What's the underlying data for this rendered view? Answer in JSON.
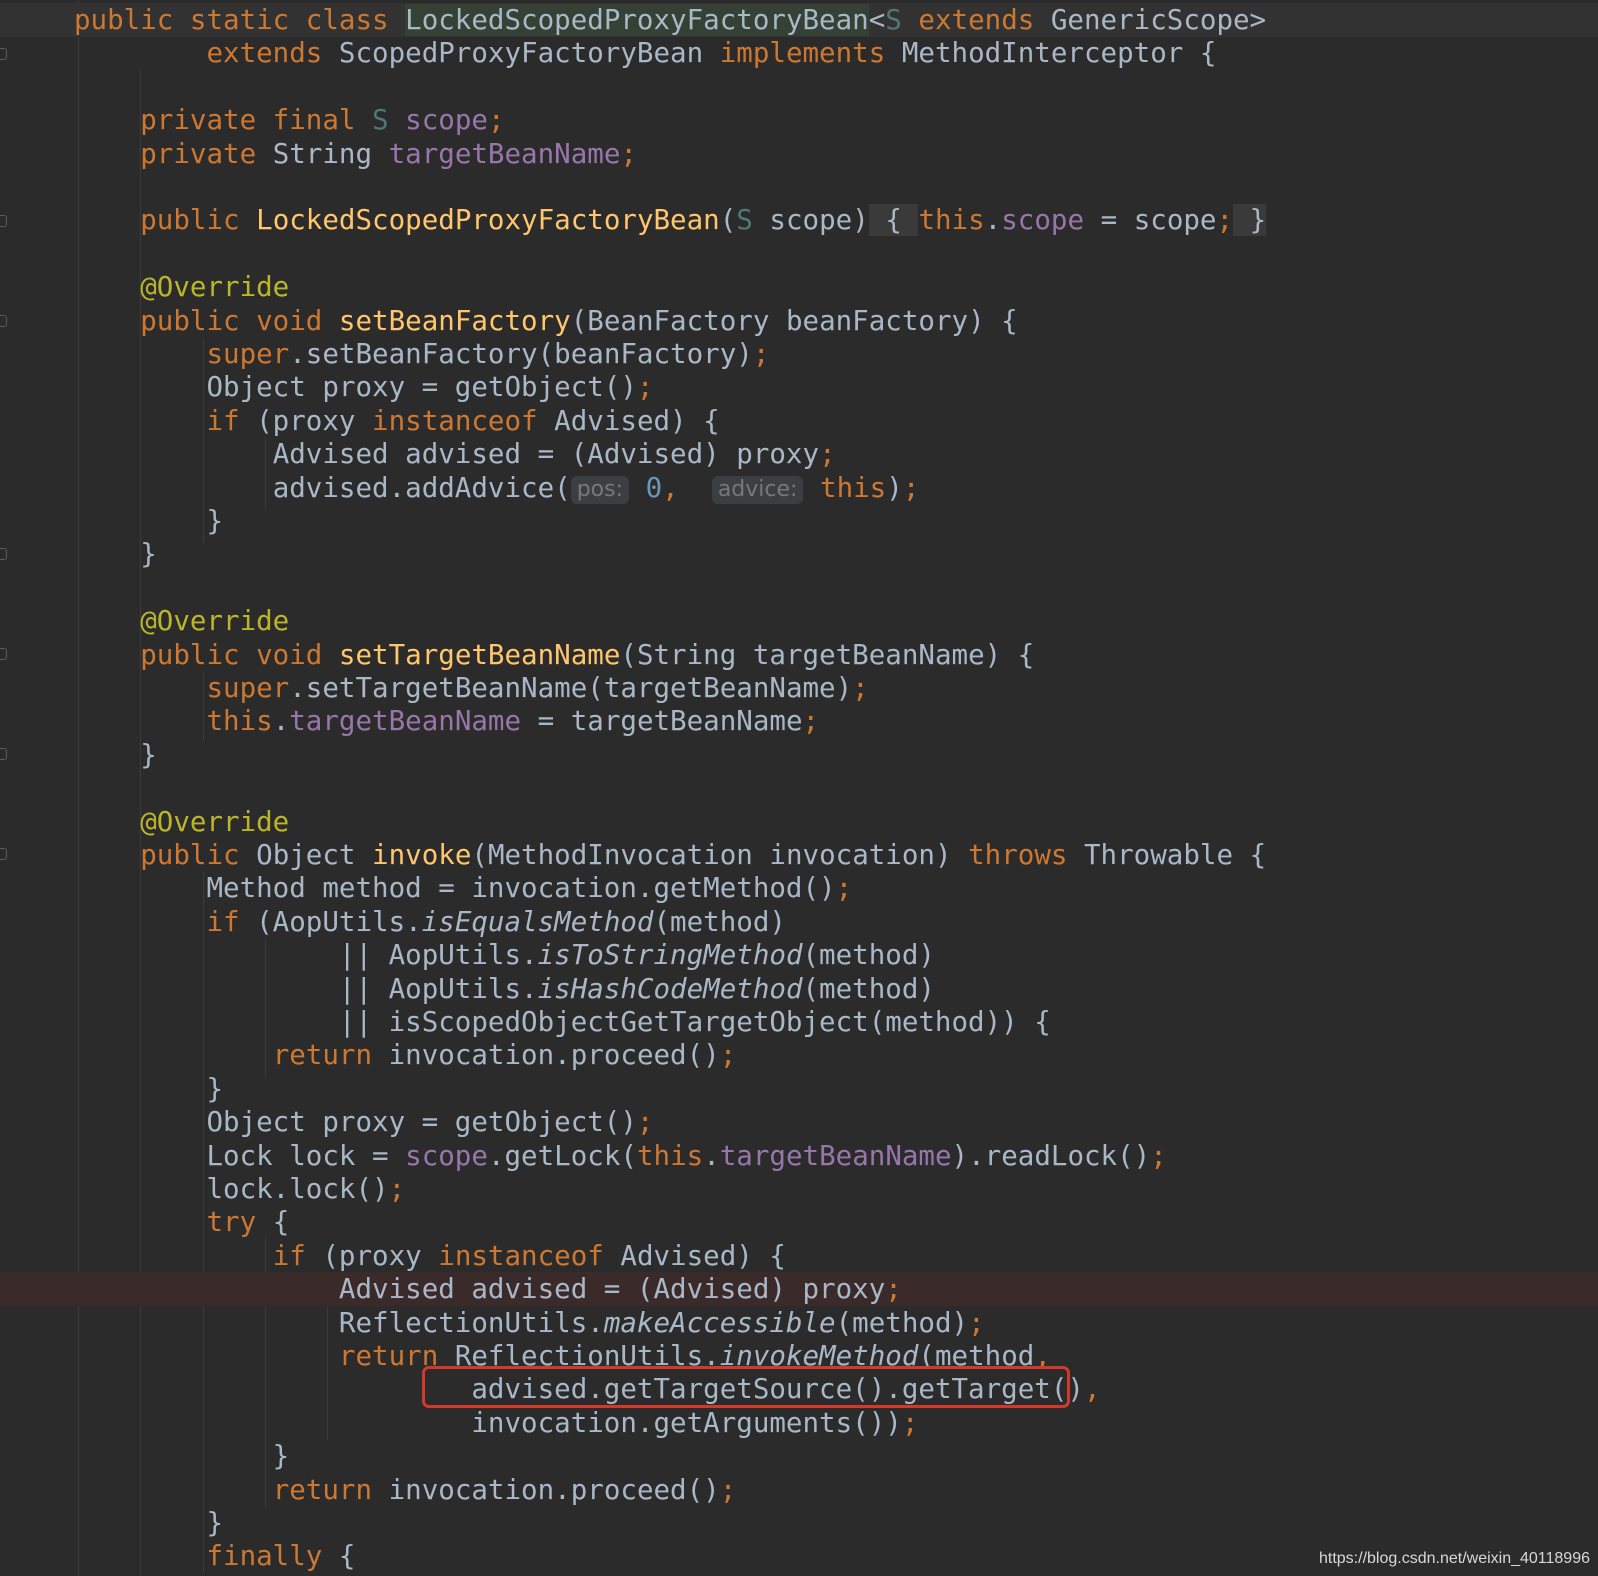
{
  "editor": {
    "lines": [
      [
        [
          "public static class ",
          "kw"
        ],
        [
          "LockedScopedProxyFactoryBean",
          "cls-hl"
        ],
        [
          "<",
          ""
        ],
        [
          "S",
          "tp"
        ],
        [
          " extends ",
          "kw"
        ],
        [
          "GenericScope>",
          ""
        ]
      ],
      [
        [
          "        ",
          ""
        ],
        [
          "extends ",
          "kw"
        ],
        [
          "ScopedProxyFactoryBean ",
          ""
        ],
        [
          "implements ",
          "kw"
        ],
        [
          "MethodInterceptor {",
          ""
        ]
      ],
      [],
      [
        [
          "    ",
          ""
        ],
        [
          "private final ",
          "kw"
        ],
        [
          "S ",
          "tp"
        ],
        [
          "scope",
          "fld"
        ],
        [
          ";",
          "kw"
        ]
      ],
      [
        [
          "    ",
          ""
        ],
        [
          "private ",
          "kw"
        ],
        [
          "String ",
          ""
        ],
        [
          "targetBeanName",
          "fld"
        ],
        [
          ";",
          "kw"
        ]
      ],
      [],
      [
        [
          "    ",
          ""
        ],
        [
          "public ",
          "kw"
        ],
        [
          "LockedScopedProxyFactoryBean",
          "mdecl"
        ],
        [
          "(",
          ""
        ],
        [
          "S ",
          "tp"
        ],
        [
          "scope)",
          ""
        ],
        [
          " { ",
          "fold-bg"
        ],
        [
          "this",
          "kw"
        ],
        [
          ".",
          ""
        ],
        [
          "scope",
          "fld"
        ],
        [
          " = scope",
          ""
        ],
        [
          ";",
          "kw"
        ],
        [
          " }",
          "fold-bg"
        ]
      ],
      [],
      [
        [
          "    ",
          ""
        ],
        [
          "@Override",
          "ann"
        ]
      ],
      [
        [
          "    ",
          ""
        ],
        [
          "public void ",
          "kw"
        ],
        [
          "setBeanFactory",
          "mdecl"
        ],
        [
          "(BeanFactory beanFactory) {",
          ""
        ]
      ],
      [
        [
          "        ",
          ""
        ],
        [
          "super",
          "kw"
        ],
        [
          ".setBeanFactory(beanFactory)",
          ""
        ],
        [
          ";",
          "kw"
        ]
      ],
      [
        [
          "        ",
          ""
        ],
        [
          "Object proxy = getObject()",
          ""
        ],
        [
          ";",
          "kw"
        ]
      ],
      [
        [
          "        ",
          ""
        ],
        [
          "if ",
          "kw"
        ],
        [
          "(proxy ",
          ""
        ],
        [
          "instanceof ",
          "kw"
        ],
        [
          "Advised) {",
          ""
        ]
      ],
      [
        [
          "            ",
          ""
        ],
        [
          "Advised advised = (Advised) proxy",
          ""
        ],
        [
          ";",
          "kw"
        ]
      ],
      [
        [
          "            ",
          ""
        ],
        [
          "advised.addAdvice(",
          ""
        ],
        [
          "pos:",
          "hint"
        ],
        [
          " ",
          ""
        ],
        [
          "0",
          "num"
        ],
        [
          ",",
          "kw"
        ],
        [
          "  ",
          ""
        ],
        [
          "advice:",
          "hint"
        ],
        [
          " ",
          ""
        ],
        [
          "this",
          "kw"
        ],
        [
          ")",
          ""
        ],
        [
          ";",
          "kw"
        ]
      ],
      [
        [
          "        }",
          ""
        ]
      ],
      [
        [
          "    }",
          ""
        ]
      ],
      [],
      [
        [
          "    ",
          ""
        ],
        [
          "@Override",
          "ann"
        ]
      ],
      [
        [
          "    ",
          ""
        ],
        [
          "public void ",
          "kw"
        ],
        [
          "setTargetBeanName",
          "mdecl"
        ],
        [
          "(String targetBeanName) {",
          ""
        ]
      ],
      [
        [
          "        ",
          ""
        ],
        [
          "super",
          "kw"
        ],
        [
          ".setTargetBeanName(targetBeanName)",
          ""
        ],
        [
          ";",
          "kw"
        ]
      ],
      [
        [
          "        ",
          ""
        ],
        [
          "this",
          "kw"
        ],
        [
          ".",
          ""
        ],
        [
          "targetBeanName",
          "fld"
        ],
        [
          " = targetBeanName",
          ""
        ],
        [
          ";",
          "kw"
        ]
      ],
      [
        [
          "    }",
          ""
        ]
      ],
      [],
      [
        [
          "    ",
          ""
        ],
        [
          "@Override",
          "ann"
        ]
      ],
      [
        [
          "    ",
          ""
        ],
        [
          "public ",
          "kw"
        ],
        [
          "Object ",
          ""
        ],
        [
          "invoke",
          "mdecl"
        ],
        [
          "(MethodInvocation invocation) ",
          ""
        ],
        [
          "throws ",
          "kw"
        ],
        [
          "Throwable {",
          ""
        ]
      ],
      [
        [
          "        ",
          ""
        ],
        [
          "Method method = invocation.getMethod()",
          ""
        ],
        [
          ";",
          "kw"
        ]
      ],
      [
        [
          "        ",
          ""
        ],
        [
          "if ",
          "kw"
        ],
        [
          "(AopUtils.",
          ""
        ],
        [
          "isEqualsMethod",
          "ital"
        ],
        [
          "(method)",
          ""
        ]
      ],
      [
        [
          "                ",
          ""
        ],
        [
          "|| AopUtils.",
          ""
        ],
        [
          "isToStringMethod",
          "ital"
        ],
        [
          "(method)",
          ""
        ]
      ],
      [
        [
          "                ",
          ""
        ],
        [
          "|| AopUtils.",
          ""
        ],
        [
          "isHashCodeMethod",
          "ital"
        ],
        [
          "(method)",
          ""
        ]
      ],
      [
        [
          "                ",
          ""
        ],
        [
          "|| isScopedObjectGetTargetObject(method)) {",
          ""
        ]
      ],
      [
        [
          "            ",
          ""
        ],
        [
          "return ",
          "kw"
        ],
        [
          "invocation.proceed()",
          ""
        ],
        [
          ";",
          "kw"
        ]
      ],
      [
        [
          "        }",
          ""
        ]
      ],
      [
        [
          "        ",
          ""
        ],
        [
          "Object proxy = getObject()",
          ""
        ],
        [
          ";",
          "kw"
        ]
      ],
      [
        [
          "        ",
          ""
        ],
        [
          "Lock lock = ",
          ""
        ],
        [
          "scope",
          "fld"
        ],
        [
          ".getLock(",
          ""
        ],
        [
          "this",
          "kw"
        ],
        [
          ".",
          ""
        ],
        [
          "targetBeanName",
          "fld"
        ],
        [
          ").readLock()",
          ""
        ],
        [
          ";",
          "kw"
        ]
      ],
      [
        [
          "        ",
          ""
        ],
        [
          "lock.lock()",
          ""
        ],
        [
          ";",
          "kw"
        ]
      ],
      [
        [
          "        ",
          ""
        ],
        [
          "try ",
          "kw"
        ],
        [
          "{",
          ""
        ]
      ],
      [
        [
          "            ",
          ""
        ],
        [
          "if ",
          "kw"
        ],
        [
          "(proxy ",
          ""
        ],
        [
          "instanceof ",
          "kw"
        ],
        [
          "Advised) {",
          ""
        ]
      ],
      [
        [
          "                ",
          ""
        ],
        [
          "Advised advised = (Advised) proxy",
          ""
        ],
        [
          ";",
          "kw"
        ]
      ],
      [
        [
          "                ",
          ""
        ],
        [
          "ReflectionUtils.",
          ""
        ],
        [
          "makeAccessible",
          "ital"
        ],
        [
          "(method)",
          ""
        ],
        [
          ";",
          "kw"
        ]
      ],
      [
        [
          "                ",
          ""
        ],
        [
          "return ",
          "kw"
        ],
        [
          "ReflectionUtils.",
          ""
        ],
        [
          "invokeMethod",
          "ital"
        ],
        [
          "(method",
          ""
        ],
        [
          ",",
          "kw"
        ]
      ],
      [
        [
          "                        ",
          ""
        ],
        [
          "advised.getTargetSource().getTarget()",
          ""
        ],
        [
          ",",
          "kw"
        ]
      ],
      [
        [
          "                        ",
          ""
        ],
        [
          "invocation.getArguments())",
          ""
        ],
        [
          ";",
          "kw"
        ]
      ],
      [
        [
          "            }",
          ""
        ]
      ],
      [
        [
          "            ",
          ""
        ],
        [
          "return ",
          "kw"
        ],
        [
          "invocation.proceed()",
          ""
        ],
        [
          ";",
          "kw"
        ]
      ],
      [
        [
          "        }",
          ""
        ]
      ],
      [
        [
          "        ",
          ""
        ],
        [
          "finally ",
          "kw"
        ],
        [
          "{",
          ""
        ]
      ]
    ]
  },
  "watermark": "https://blog.csdn.net/weixin_40118996"
}
